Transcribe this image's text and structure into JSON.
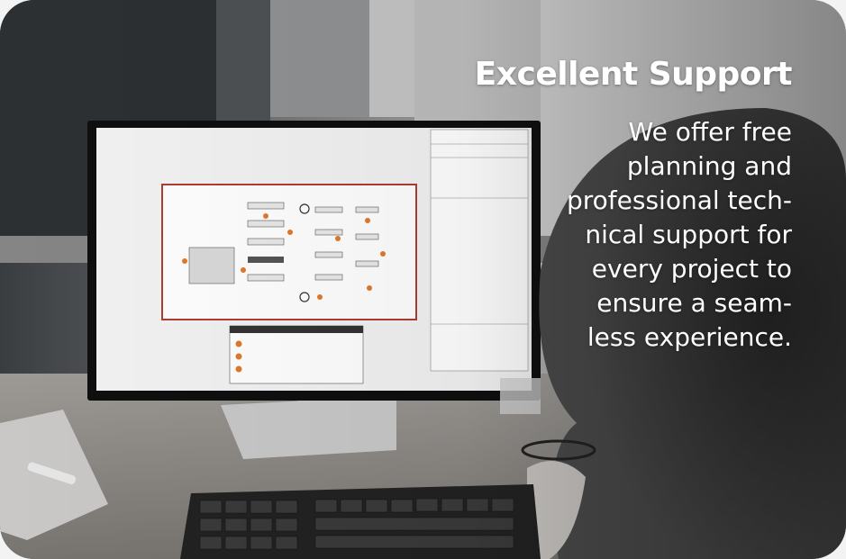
{
  "card": {
    "title": "Excellent Support",
    "body_lines": [
      "We offer free",
      "planning and",
      "professional tech-",
      "nical support for",
      "every project to",
      "ensure a seam-",
      "less experience."
    ]
  },
  "colors": {
    "text": "#ffffff",
    "plan_accent": "#e07a2f",
    "plan_walls": "#c0392b"
  }
}
